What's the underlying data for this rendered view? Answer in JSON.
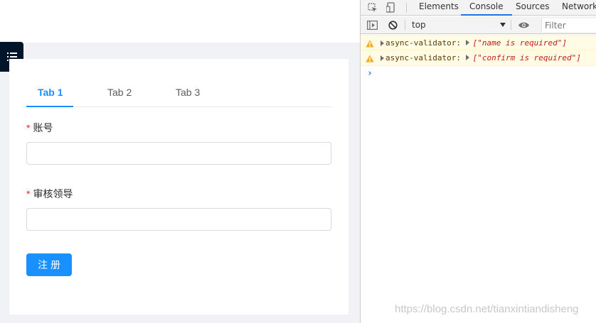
{
  "form": {
    "tabs": [
      {
        "label": "Tab 1",
        "active": true
      },
      {
        "label": "Tab 2",
        "active": false
      },
      {
        "label": "Tab 3",
        "active": false
      }
    ],
    "required_marker": "*",
    "fields": [
      {
        "label": "账号",
        "value": ""
      },
      {
        "label": "审核领导",
        "value": ""
      }
    ],
    "submit_label": "注册"
  },
  "devtools": {
    "tabs": [
      "Elements",
      "Console",
      "Sources",
      "Network"
    ],
    "active_tab": "Console",
    "context": "top",
    "filter_placeholder": "Filter",
    "messages": [
      {
        "level": "warning",
        "source": "async-validator:",
        "payload": "[\"name is required\"]"
      },
      {
        "level": "warning",
        "source": "async-validator:",
        "payload": "[\"confirm is required\"]"
      }
    ],
    "prompt": "›"
  },
  "watermark": "https://blog.csdn.net/tianxintiandisheng",
  "colors": {
    "primary": "#1890ff",
    "required": "#f5222d",
    "sidebar": "#001529",
    "page_bg": "#f0f2f5",
    "warning_bg": "#fffbe5",
    "devtools_accent": "#1a73e8"
  },
  "icons": {
    "menu_toggle": "unordered-list-icon",
    "inspect": "inspect-element-icon",
    "device": "device-toolbar-icon",
    "sidebar_toggle": "console-sidebar-icon",
    "clear": "clear-console-icon",
    "eye": "live-expression-icon",
    "warning": "warning-icon"
  }
}
